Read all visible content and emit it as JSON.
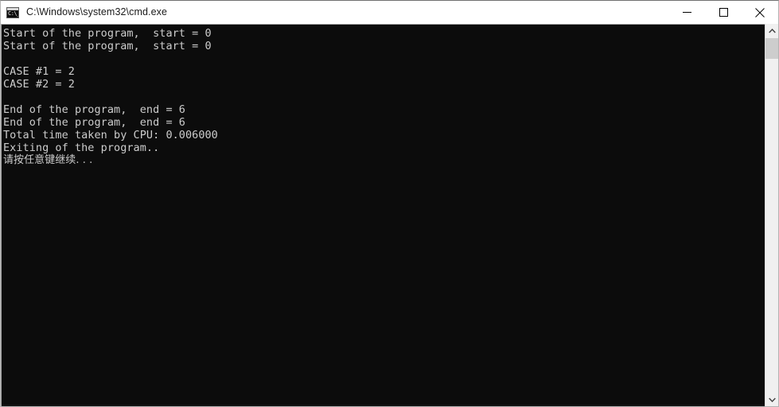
{
  "window": {
    "title": "C:\\Windows\\system32\\cmd.exe",
    "icon_name": "cmd-console-icon",
    "icon_glyph": "C:\\_",
    "colors": {
      "titlebar_bg": "#ffffff",
      "titlebar_text": "#1a1a1a",
      "console_bg": "#0c0c0c",
      "console_text": "#cccccc",
      "scrollbar_track": "#f0f0f0",
      "scrollbar_thumb": "#cdcdcd",
      "window_border": "#b3b3b3"
    }
  },
  "controls": {
    "minimize_label": "Minimize",
    "maximize_label": "Maximize",
    "close_label": "Close"
  },
  "console": {
    "lines": [
      "Start of the program,  start = 0",
      "Start of the program,  start = 0",
      "",
      "CASE #1 = 2",
      "CASE #2 = 2",
      "",
      "End of the program,  end = 6",
      "End of the program,  end = 6",
      "Total time taken by CPU: 0.006000",
      "Exiting of the program..",
      "请按任意键继续. . ."
    ]
  },
  "scrollbar": {
    "up_arrow_label": "Scroll up",
    "down_arrow_label": "Scroll down",
    "thumb_label": "Vertical scroll thumb"
  }
}
